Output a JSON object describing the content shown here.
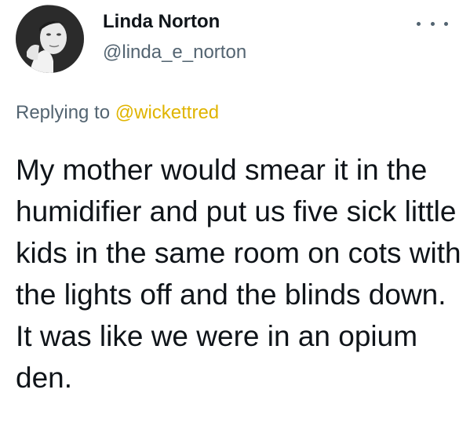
{
  "author": {
    "display_name": "Linda Norton",
    "handle": "@linda_e_norton"
  },
  "reply": {
    "prefix": "Replying to",
    "mention": "@wickettred"
  },
  "tweet": {
    "text": "My mother would smear it in the humidifier and put us five sick little kids in the same room on cots with the lights off and the blinds down. It was like we were in an opium den."
  },
  "icons": {
    "more": "more-options-icon",
    "avatar": "profile-avatar"
  },
  "colors": {
    "name": "#0f1419",
    "secondary": "#536471",
    "mention": "#e0b400",
    "body": "#0f1419"
  }
}
